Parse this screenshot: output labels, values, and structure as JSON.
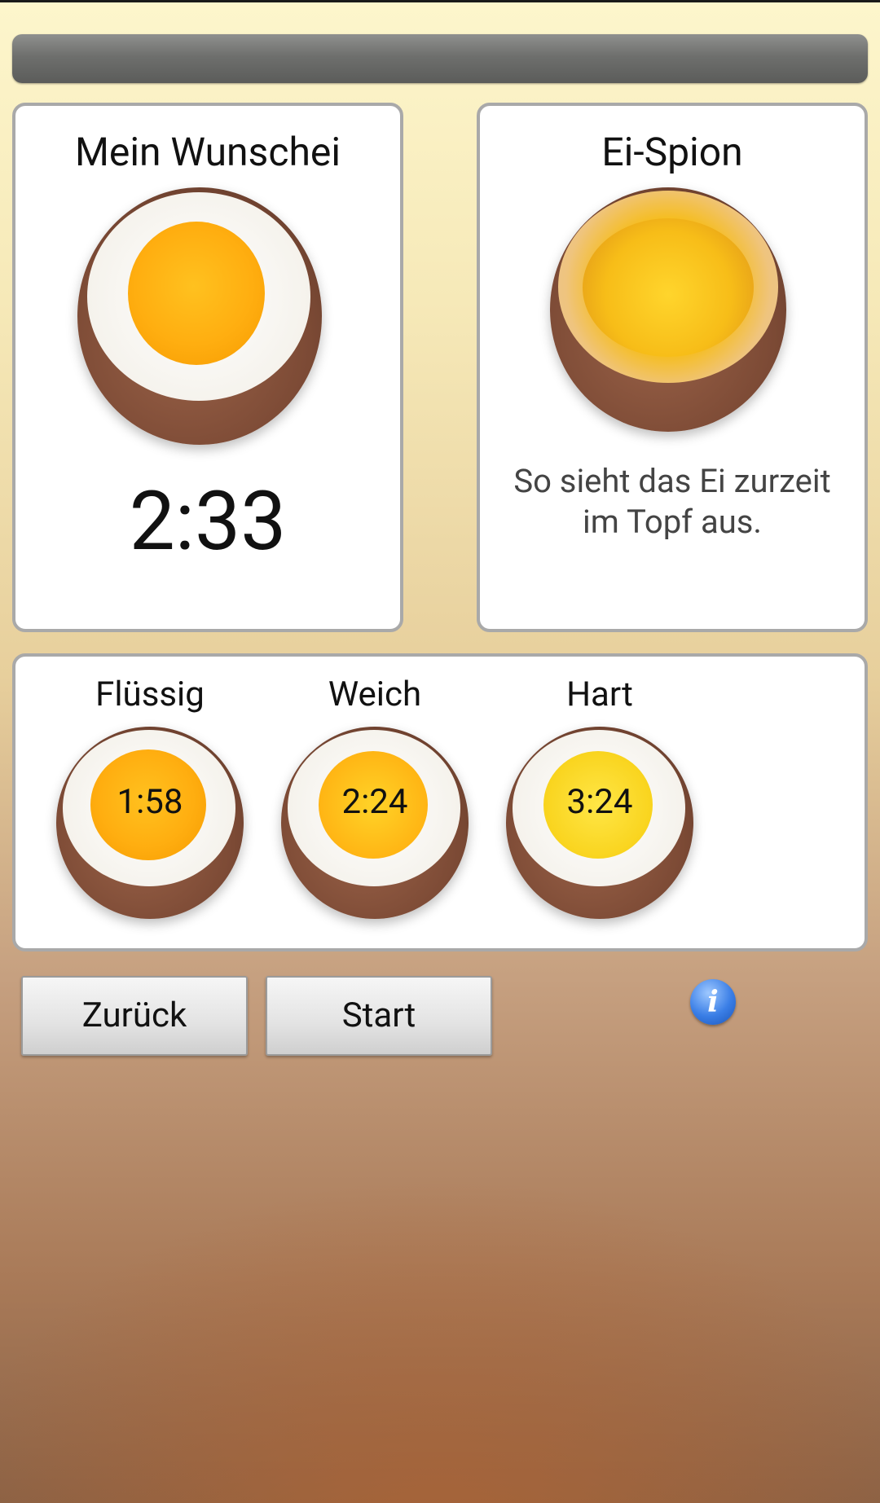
{
  "header": {
    "progress_bar": "progress"
  },
  "wish_card": {
    "title": "Mein Wunschei",
    "time": "2:33"
  },
  "spy_card": {
    "title": "Ei-Spion",
    "description_line1": "So sieht das Ei zurzeit",
    "description_line2": "im Topf aus."
  },
  "presets": [
    {
      "label": "Flüssig",
      "time": "1:58",
      "yolk": "runny"
    },
    {
      "label": "Weich",
      "time": "2:24",
      "yolk": "soft"
    },
    {
      "label": "Hart",
      "time": "3:24",
      "yolk": "hard"
    }
  ],
  "buttons": {
    "back": "Zurück",
    "start": "Start"
  },
  "icons": {
    "info": "i"
  }
}
